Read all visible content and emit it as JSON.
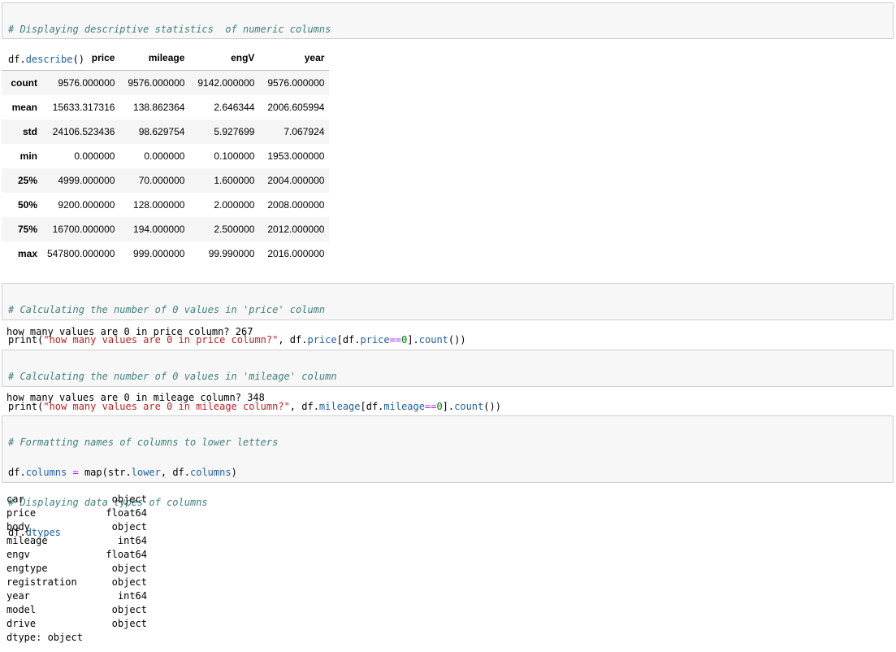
{
  "cell1": {
    "comment": "# Displaying descriptive statistics  of numeric columns",
    "code": {
      "obj": "df.",
      "attr": "describe",
      "tail": "()"
    }
  },
  "describe_table": {
    "columns": [
      "price",
      "mileage",
      "engV",
      "year"
    ],
    "rows": [
      {
        "label": "count",
        "values": [
          "9576.000000",
          "9576.000000",
          "9142.000000",
          "9576.000000"
        ]
      },
      {
        "label": "mean",
        "values": [
          "15633.317316",
          "138.862364",
          "2.646344",
          "2006.605994"
        ]
      },
      {
        "label": "std",
        "values": [
          "24106.523436",
          "98.629754",
          "5.927699",
          "7.067924"
        ]
      },
      {
        "label": "min",
        "values": [
          "0.000000",
          "0.000000",
          "0.100000",
          "1953.000000"
        ]
      },
      {
        "label": "25%",
        "values": [
          "4999.000000",
          "70.000000",
          "1.600000",
          "2004.000000"
        ]
      },
      {
        "label": "50%",
        "values": [
          "9200.000000",
          "128.000000",
          "2.000000",
          "2008.000000"
        ]
      },
      {
        "label": "75%",
        "values": [
          "16700.000000",
          "194.000000",
          "2.500000",
          "2012.000000"
        ]
      },
      {
        "label": "max",
        "values": [
          "547800.000000",
          "999.000000",
          "99.990000",
          "2016.000000"
        ]
      }
    ]
  },
  "cell2": {
    "comment": "# Calculating the number of 0 values in 'price' column",
    "fn": "print(",
    "str": "\"how many values are 0 in price column?\"",
    "mid": ", df.",
    "attr1": "price",
    "lb": "[df.",
    "attr2": "price",
    "op": "==",
    "num": "0",
    "rb": "].",
    "attr3": "count",
    "end": "())",
    "output": "how many values are 0 in price column? 267"
  },
  "cell3": {
    "comment": "# Calculating the number of 0 values in 'mileage' column",
    "fn": "print(",
    "str": "\"how many values are 0 in mileage column?\"",
    "mid": ", df.",
    "attr1": "mileage",
    "lb": "[df.",
    "attr2": "mileage",
    "op": "==",
    "num": "0",
    "rb": "].",
    "attr3": "count",
    "end": "())",
    "output": "how many values are 0 in mileage column? 348"
  },
  "cell4": {
    "comment1": "# Formatting names of columns to lower letters",
    "l2a": "df.",
    "l2b": "columns",
    "l2c": " = ",
    "l2d": "map(str.",
    "l2e": "lower",
    "l2f": ", df.",
    "l2g": "columns",
    "l2h": ")",
    "comment2": "# Displaying data types of columns",
    "l4a": "df.",
    "l4b": "dtypes"
  },
  "dtypes_output": {
    "rows": [
      {
        "name": "car",
        "type": "object"
      },
      {
        "name": "price",
        "type": "float64"
      },
      {
        "name": "body",
        "type": "object"
      },
      {
        "name": "mileage",
        "type": "int64"
      },
      {
        "name": "engv",
        "type": "float64"
      },
      {
        "name": "engtype",
        "type": "object"
      },
      {
        "name": "registration",
        "type": "object"
      },
      {
        "name": "year",
        "type": "int64"
      },
      {
        "name": "model",
        "type": "object"
      },
      {
        "name": "drive",
        "type": "object"
      }
    ],
    "footer": "dtype: object"
  }
}
